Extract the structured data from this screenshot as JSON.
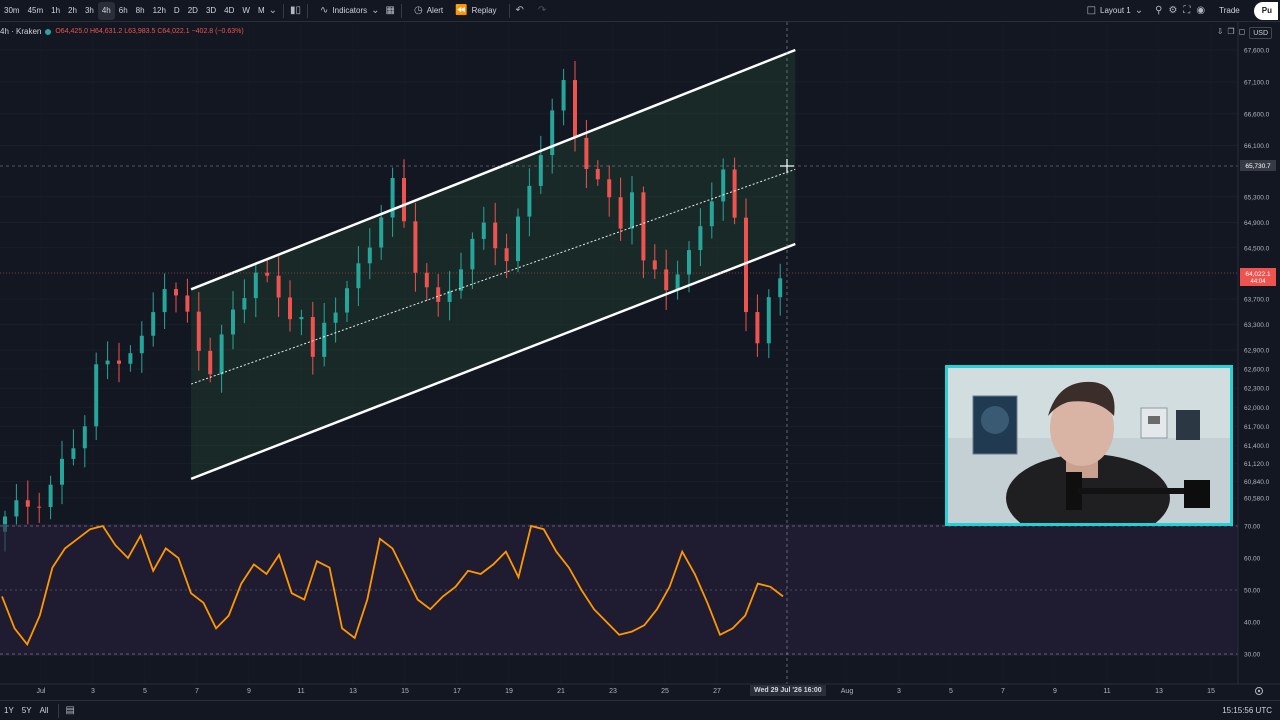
{
  "toolbar": {
    "timeframes": [
      "30m",
      "45m",
      "1h",
      "2h",
      "3h",
      "4h",
      "6h",
      "8h",
      "12h",
      "D",
      "2D",
      "3D",
      "4D",
      "W",
      "M"
    ],
    "active_timeframe": "4h",
    "indicators_label": "Indicators",
    "alert_label": "Alert",
    "replay_label": "Replay",
    "layout_label": "Layout 1",
    "trade_label": "Trade",
    "publish_label": "Pu"
  },
  "legend": {
    "symbol": "4h · Kraken",
    "ohlc": "O64,425.0 H64,631.2 L63,983.5 C64,022.1 −402.8 (−0.63%)",
    "status_color": "#26a69a"
  },
  "currency": "USD",
  "crosshair": {
    "price_label": "65,730.7",
    "time_label": "Wed 29 Jul '26  16:00"
  },
  "last_price": {
    "value_label": "64,022.1",
    "countdown": "44:04"
  },
  "bottombar": {
    "ranges": [
      "1Y",
      "5Y",
      "All"
    ],
    "clock": "15:15:56 UTC"
  },
  "colors": {
    "up": "#26a69a",
    "down": "#ef5350",
    "rsi": "#ff9800",
    "channel": "#ffffff",
    "webcam_border": "#23d1d7"
  },
  "chart_data": [
    {
      "type": "candlestick",
      "price_axis_labels": [
        "67,600.0",
        "67,100.0",
        "66,600.0",
        "66,100.0",
        "65,300.0",
        "64,900.0",
        "64,500.0",
        "63,700.0",
        "63,300.0",
        "62,900.0",
        "62,600.0",
        "62,300.0",
        "62,000.0",
        "61,700.0",
        "61,400.0",
        "61,120.0",
        "60,840.0",
        "60,580.0"
      ],
      "date_axis_labels": [
        "Jul",
        "3",
        "5",
        "7",
        "9",
        "11",
        "13",
        "15",
        "17",
        "19",
        "21",
        "23",
        "25",
        "27",
        "Aug",
        "3",
        "5",
        "7",
        "9",
        "11",
        "13",
        "15"
      ],
      "price_path": [
        [
          0,
          60200
        ],
        [
          4,
          60800
        ],
        [
          7,
          61700
        ],
        [
          8,
          62500
        ],
        [
          10,
          62900
        ],
        [
          12,
          63000
        ],
        [
          14,
          63900
        ],
        [
          16,
          63400
        ],
        [
          18,
          62700
        ],
        [
          20,
          63400
        ],
        [
          22,
          64100
        ],
        [
          24,
          63800
        ],
        [
          26,
          63400
        ],
        [
          27,
          62600
        ],
        [
          28,
          63300
        ],
        [
          30,
          63800
        ],
        [
          32,
          64700
        ],
        [
          34,
          65400
        ],
        [
          35,
          64800
        ],
        [
          36,
          64200
        ],
        [
          38,
          63600
        ],
        [
          40,
          64300
        ],
        [
          42,
          64700
        ],
        [
          44,
          64400
        ],
        [
          46,
          65500
        ],
        [
          47,
          66100
        ],
        [
          48,
          66600
        ],
        [
          49,
          66900
        ],
        [
          50,
          66200
        ],
        [
          52,
          65600
        ],
        [
          54,
          64900
        ],
        [
          55,
          65400
        ],
        [
          56,
          64100
        ],
        [
          58,
          64000
        ],
        [
          60,
          64400
        ],
        [
          62,
          65300
        ],
        [
          63,
          65600
        ],
        [
          64,
          64800
        ],
        [
          65,
          63600
        ],
        [
          66,
          63200
        ],
        [
          67,
          63700
        ],
        [
          68,
          64022.1
        ]
      ],
      "channel_upper": [
        [
          16,
          63850
        ],
        [
          69,
          67600
        ]
      ],
      "channel_lower": [
        [
          16,
          60880
        ],
        [
          69,
          64560
        ]
      ],
      "channel_midline": [
        [
          16,
          62365
        ],
        [
          69,
          65730.7
        ]
      ]
    },
    {
      "type": "line",
      "name": "RSI",
      "y_axis_labels": [
        "70.00",
        "60.00",
        "50.00",
        "40.00",
        "30.00"
      ],
      "ylim": [
        26,
        74
      ],
      "bands": [
        70,
        30
      ],
      "values": [
        48,
        38,
        33,
        42,
        57,
        63,
        66,
        69,
        70,
        64,
        60,
        67,
        56,
        63,
        60,
        49,
        46,
        38,
        42,
        52,
        58,
        55,
        61,
        49,
        47,
        59,
        57,
        38,
        35,
        47,
        66,
        63,
        55,
        47,
        44,
        48,
        51,
        56,
        55,
        58,
        62,
        54,
        70,
        69,
        62,
        57,
        50,
        44,
        40,
        36,
        37,
        39,
        44,
        51,
        62,
        55,
        46,
        36,
        38,
        42,
        52,
        51,
        48
      ]
    }
  ]
}
